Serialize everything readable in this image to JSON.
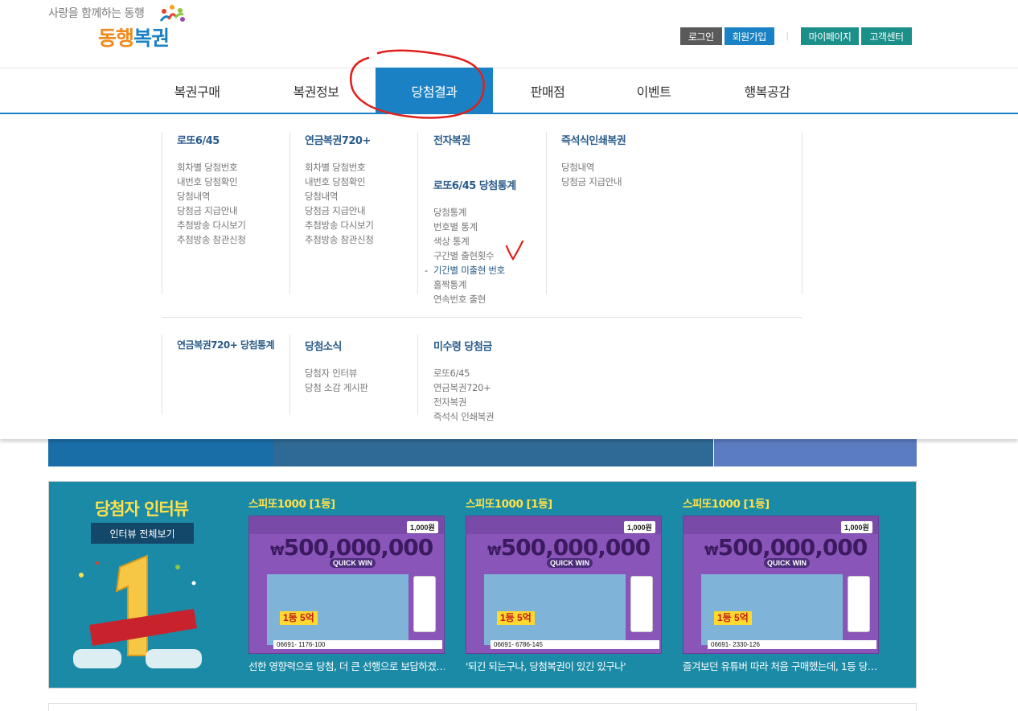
{
  "header": {
    "tagline": "사랑을 함께하는 동행",
    "brand_part1": "동행",
    "brand_part2": "복권",
    "login": "로그인",
    "join": "회원가입",
    "separator": "|",
    "mypage": "마이페이지",
    "support": "고객센터"
  },
  "nav": {
    "items": [
      {
        "label": "복권구매"
      },
      {
        "label": "복권정보"
      },
      {
        "label": "당첨결과"
      },
      {
        "label": "판매점"
      },
      {
        "label": "이벤트"
      },
      {
        "label": "행복공감"
      }
    ],
    "active_index": 2
  },
  "mega": {
    "lotto645": {
      "title": "로또6/45",
      "links": [
        "회차별 당첨번호",
        "내번호 당첨확인",
        "당첨내역",
        "당첨금 지급안내",
        "추첨방송 다시보기",
        "추첨방송 참관신청"
      ]
    },
    "pension720": {
      "title": "연금복권720+",
      "links": [
        "회차별 당첨번호",
        "내번호 당첨확인",
        "당첨내역",
        "당첨금 지급안내",
        "추첨방송 다시보기",
        "추첨방송 참관신청"
      ]
    },
    "electronic": {
      "title": "전자복권"
    },
    "lotto_stats": {
      "title": "로또6/45 당첨통계",
      "links": [
        "당첨통계",
        "번호별 통계",
        "색상 통계",
        "구간별 출현횟수",
        "기간별 미출현 번호",
        "홀짝통계",
        "연속번호 출현"
      ],
      "current_index": 4
    },
    "instant": {
      "title": "즉석식인쇄복권",
      "links": [
        "당첨내역",
        "당첨금 지급안내"
      ]
    },
    "pension_stats": {
      "title": "연금복권720+ 당첨통계"
    },
    "news": {
      "title": "당첨소식",
      "links": [
        "당첨자 인터뷰",
        "당첨 소감 게시판"
      ]
    },
    "unclaimed": {
      "title": "미수령 당첨금",
      "links": [
        "로또6/45",
        "연금복권720+",
        "전자복권",
        "즉석식 인쇄복권"
      ]
    }
  },
  "interview": {
    "title": "당첨자 인터뷰",
    "view_all": "인터뷰 전체보기",
    "cards": [
      {
        "title": "스피또1000 [1등]",
        "caption": "선한 영향력으로 당첨, 더 큰 선행으로 보답하겠…",
        "amount": "500,000,000",
        "serial": "06691-   1176-100"
      },
      {
        "title": "스피또1000 [1등]",
        "caption": "'되긴 되는구나, 당첨복권이 있긴 있구나'",
        "amount": "500,000,000",
        "serial": "06691-   6786-145"
      },
      {
        "title": "스피또1000 [1등]",
        "caption": "즐겨보던 유튜버 따라 처음 구매했는데, 1등 당…",
        "amount": "500,000,000",
        "serial": "06691-   2330-126"
      }
    ],
    "ticket_price": "1,000원",
    "quick_win": "QUICK WIN",
    "first_prize": "1등 5억"
  },
  "colors": {
    "brand_blue": "#1a82c4",
    "teal": "#1b8f8a",
    "interview_bg": "#1a8aa6",
    "highlight_yellow": "#ffe14a"
  }
}
